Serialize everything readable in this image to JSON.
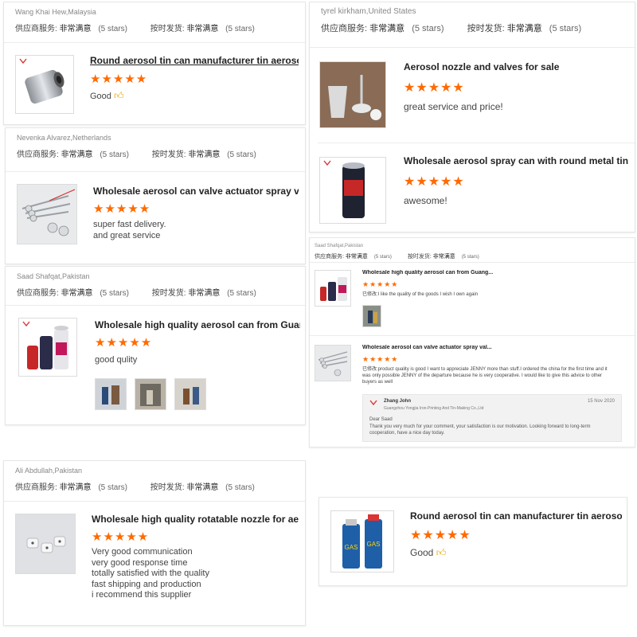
{
  "labels": {
    "service": "供应商服务:",
    "shipping": "按时发货:",
    "very_satisfied": "非常满意",
    "five_stars": "(5 stars)",
    "stars_glyph": "★★★★★"
  },
  "colors": {
    "star": "#ff6a00",
    "link_text": "#222222",
    "muted": "#888888"
  },
  "left_cards": [
    {
      "reviewer": "Wang Khai Hew,Malaysia",
      "product_title": "Round aerosol tin can manufacturer tin aerosol...",
      "comment": "Good",
      "comment_icon": "thumbs-up-icon"
    },
    {
      "reviewer": "Nevenka Alvarez,Netherlands",
      "product_title": "Wholesale aerosol can valve actuator spray val...",
      "comment_lines": [
        "super fast delivery.",
        "and great service"
      ]
    },
    {
      "reviewer": "Saad Shafqat,Pakistan",
      "product_title": "Wholesale high quality aerosol can from Guang...",
      "comment": "good qulity",
      "attachments": [
        "attachment-photo-1",
        "attachment-photo-2",
        "attachment-photo-3"
      ]
    },
    {
      "reviewer": "Ali Abdullah,Pakistan",
      "product_title": "Wholesale high quality rotatable nozzle for aer...",
      "comment_lines": [
        "Very good communication",
        "very good response time",
        "totally satisfied with the quality",
        "fast shipping and production",
        "i recommend this supplier"
      ]
    }
  ],
  "right_cards": [
    {
      "reviewer": "tyrel kirkham,United States",
      "items": [
        {
          "product_title": "Aerosol nozzle and valves for sale",
          "comment": "great service and price!"
        },
        {
          "product_title": "Wholesale aerosol spray can with round metal tin can ...",
          "comment": "awesome!"
        }
      ]
    },
    {
      "reviewer": "Saad Shafqat,Pakistan",
      "items": [
        {
          "product_title": "Wholesale high quality aerosol can from Guang...",
          "comment": "已修改:I like the quality of the goods I wish I own again"
        },
        {
          "product_title": "Wholesale aerosol can valve actuator spray val...",
          "comment": "已修改:product quality is good I want to appreciate JENNY more than stuff.I ordered the china for the first time and it was only possible JENNY of the departure because he is very cooperative. I would like to give this advice to other buyers as well"
        }
      ],
      "reply": {
        "name": "Zhang John",
        "company": "Guangzhou Yongjia Iron-Printing And Tin-Making Co.,Ltd",
        "date": "15 Nov 2020",
        "greeting": "Dear Saad",
        "text": "Thank you very much for your comment, your satisfaction is our motivation. Looking forward to long-term cooperation, have a nice day today."
      }
    },
    {
      "product_title": "Round aerosol tin can manufacturer tin aerosol...",
      "comment": "Good",
      "comment_icon": "thumbs-up-icon"
    }
  ]
}
